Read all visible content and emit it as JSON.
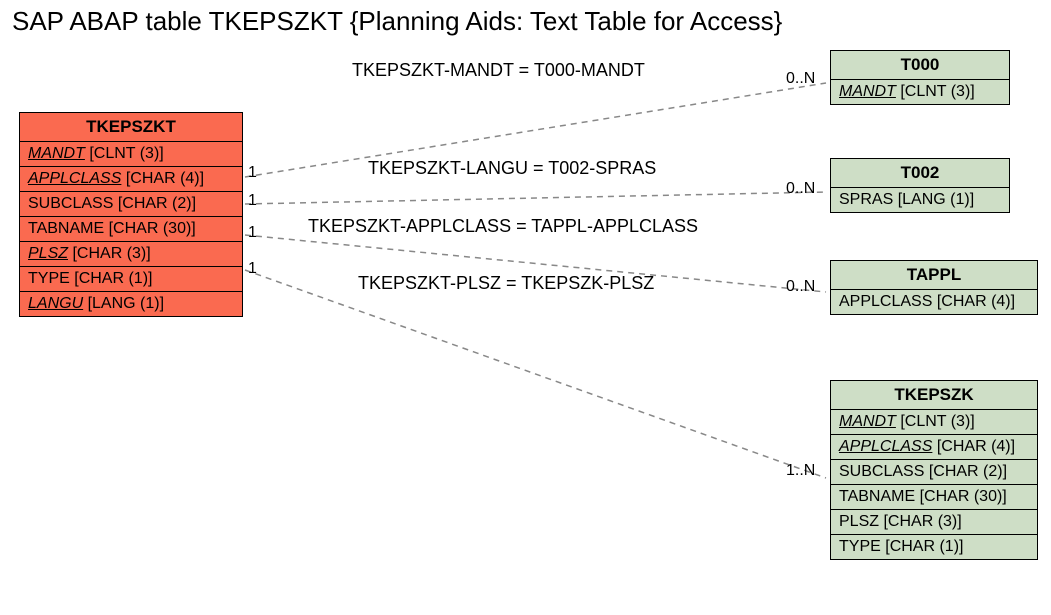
{
  "title": "SAP ABAP table TKEPSZKT {Planning Aids: Text Table for Access}",
  "main": {
    "name": "TKEPSZKT",
    "fields": [
      {
        "name": "MANDT",
        "type": "[CLNT (3)]",
        "fk": true
      },
      {
        "name": "APPLCLASS",
        "type": "[CHAR (4)]",
        "fk": true
      },
      {
        "name": "SUBCLASS",
        "type": "[CHAR (2)]",
        "fk": false
      },
      {
        "name": "TABNAME",
        "type": "[CHAR (30)]",
        "fk": false
      },
      {
        "name": "PLSZ",
        "type": "[CHAR (3)]",
        "fk": true
      },
      {
        "name": "TYPE",
        "type": "[CHAR (1)]",
        "fk": false
      },
      {
        "name": "LANGU",
        "type": "[LANG (1)]",
        "fk": true
      }
    ]
  },
  "refs": [
    {
      "name": "T000",
      "fields": [
        {
          "name": "MANDT",
          "type": "[CLNT (3)]",
          "fk": true
        }
      ]
    },
    {
      "name": "T002",
      "fields": [
        {
          "name": "SPRAS",
          "type": "[LANG (1)]",
          "fk": false
        }
      ]
    },
    {
      "name": "TAPPL",
      "fields": [
        {
          "name": "APPLCLASS",
          "type": "[CHAR (4)]",
          "fk": false
        }
      ]
    },
    {
      "name": "TKEPSZK",
      "fields": [
        {
          "name": "MANDT",
          "type": "[CLNT (3)]",
          "fk": true
        },
        {
          "name": "APPLCLASS",
          "type": "[CHAR (4)]",
          "fk": true
        },
        {
          "name": "SUBCLASS",
          "type": "[CHAR (2)]",
          "fk": false
        },
        {
          "name": "TABNAME",
          "type": "[CHAR (30)]",
          "fk": false
        },
        {
          "name": "PLSZ",
          "type": "[CHAR (3)]",
          "fk": false
        },
        {
          "name": "TYPE",
          "type": "[CHAR (1)]",
          "fk": false
        }
      ]
    }
  ],
  "relations": [
    {
      "label": "TKEPSZKT-MANDT = T000-MANDT",
      "left_card": "1",
      "right_card": "0..N"
    },
    {
      "label": "TKEPSZKT-LANGU = T002-SPRAS",
      "left_card": "1",
      "right_card": "0..N"
    },
    {
      "label": "TKEPSZKT-APPLCLASS = TAPPL-APPLCLASS",
      "left_card": "1",
      "right_card": "0..N"
    },
    {
      "label": "TKEPSZKT-PLSZ = TKEPSZK-PLSZ",
      "left_card": "1",
      "right_card": "1..N"
    }
  ]
}
